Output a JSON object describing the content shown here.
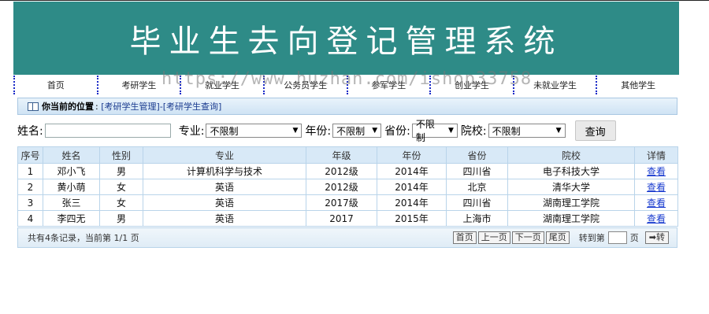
{
  "banner": {
    "title": "毕业生去向登记管理系统"
  },
  "watermark": "https://www.huzhan.com/ishop33758",
  "nav": [
    "首页",
    "考研学生",
    "就业学生",
    "公务员学生",
    "参军学生",
    "创业学生",
    "未就业学生",
    "其他学生"
  ],
  "location": {
    "label": "你当前的位置",
    "path": "[考研学生管理]-[考研学生查询]"
  },
  "filter": {
    "name_label": "姓名:",
    "name_value": "",
    "major_label": "专业:",
    "major_value": "不限制",
    "year_label": "年份:",
    "year_value": "不限制",
    "province_label": "省份:",
    "province_value": "不限制",
    "school_label": "院校:",
    "school_value": "不限制",
    "query_label": "查询"
  },
  "table": {
    "headers": [
      "序号",
      "姓名",
      "性别",
      "专业",
      "年级",
      "年份",
      "省份",
      "院校",
      "详情"
    ],
    "rows": [
      [
        "1",
        "邓小飞",
        "男",
        "计算机科学与技术",
        "2012级",
        "2014年",
        "四川省",
        "电子科技大学",
        "查看"
      ],
      [
        "2",
        "黄小萌",
        "女",
        "英语",
        "2012级",
        "2014年",
        "北京",
        "清华大学",
        "查看"
      ],
      [
        "3",
        "张三",
        "女",
        "英语",
        "2017级",
        "2014年",
        "四川省",
        "湖南理工学院",
        "查看"
      ],
      [
        "4",
        "李四无",
        "男",
        "英语",
        "2017",
        "2015年",
        "上海市",
        "湖南理工学院",
        "查看"
      ]
    ]
  },
  "footer": {
    "summary": "共有4条记录，当前第 1/1 页",
    "first": "首页",
    "prev": "上一页",
    "next": "下一页",
    "last": "尾页",
    "goto_label": "转到第",
    "page_unit": "页",
    "go": "➡转"
  }
}
